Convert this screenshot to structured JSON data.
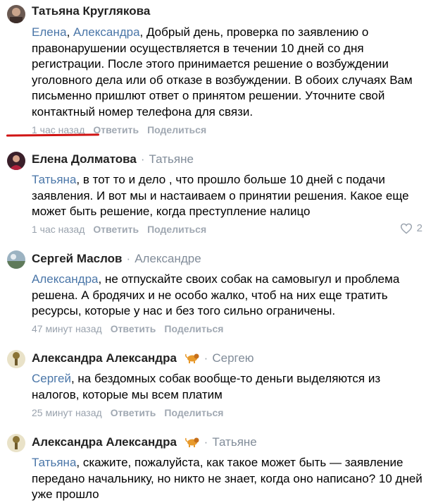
{
  "comments": [
    {
      "author": "Татьяна Круглякова",
      "reply_to": "",
      "mentions": [
        "Елена",
        "Александра"
      ],
      "mention_sep": ", ",
      "text": ", Добрый день, проверка по заявлению о правонарушении осуществляется в течении 10 дней со дня регистрации. После этого принимается решение о возбуждении уголовного дела или об отказе в возбуждении. В обоих случаях Вам письменно пришлют ответ о принятом решении. Уточните свой контактный номер телефона для связи.",
      "time": "1 час назад",
      "reply_label": "Ответить",
      "share_label": "Поделиться"
    },
    {
      "author": "Елена Долматова",
      "reply_to": "Татьяне",
      "mentions": [
        "Татьяна"
      ],
      "text": ", в тот то и дело , что прошло больше 10 дней с подачи заявления. И вот мы и настаиваем о принятии решения. Какое еще может быть решение, когда преступление налицо",
      "time": "1 час назад",
      "reply_label": "Ответить",
      "share_label": "Поделиться",
      "likes": "2"
    },
    {
      "author": "Сергей Маслов",
      "reply_to": "Александре",
      "mentions": [
        "Александра"
      ],
      "text": ", не отпускайте своих собак на самовыгул и проблема решена. А бродячих и не особо жалко, чтоб на них еще тратить ресурсы, которые у нас и без того сильно ограничены.",
      "time": "47 минут назад",
      "reply_label": "Ответить",
      "share_label": "Поделиться"
    },
    {
      "author": "Александра Александра",
      "reply_to": "Сергею",
      "mentions": [
        "Сергей"
      ],
      "text": ", на бездомных собак вообще-то деньги выделяются из налогов, которые мы всем платим",
      "time": "25 минут назад",
      "reply_label": "Ответить",
      "share_label": "Поделиться"
    },
    {
      "author": "Александра Александра",
      "reply_to": "Татьяне",
      "mentions": [
        "Татьяна"
      ],
      "text": ", скажите, пожалуйста, как такое может быть — заявление передано начальнику, но никто не знает, когда оно написано? 10 дней уже прошло",
      "time": "",
      "reply_label": "",
      "share_label": ""
    }
  ],
  "colors": {
    "mention": "#4a76a8",
    "meta": "#99a2ad",
    "underline": "#d01414"
  },
  "icons": {
    "heart": "heart-icon",
    "lion": "lion-emoji-icon"
  }
}
